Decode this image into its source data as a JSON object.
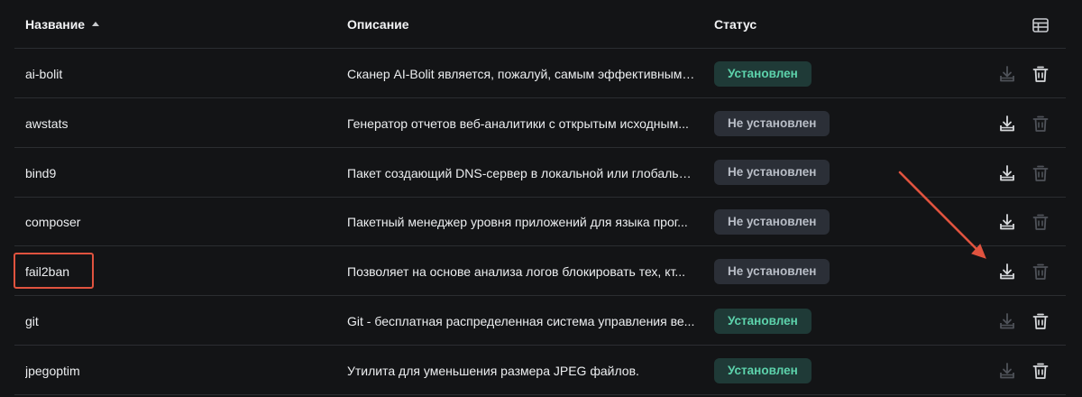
{
  "table": {
    "columns": {
      "name": "Название",
      "description": "Описание",
      "status": "Статус"
    },
    "sort_indicator": "ascending",
    "rows": [
      {
        "name": "ai-bolit",
        "description": "Сканер AI-Bolit является, пожалуй, самым эффективным ...",
        "status": "Установлен",
        "installed": true
      },
      {
        "name": "awstats",
        "description": "Генератор отчетов веб-аналитики с открытым исходным...",
        "status": "Не установлен",
        "installed": false
      },
      {
        "name": "bind9",
        "description": "Пакет создающий DNS-сервер в локальной или глобальн...",
        "status": "Не установлен",
        "installed": false
      },
      {
        "name": "composer",
        "description": "Пакетный менеджер уровня приложений для языка прог...",
        "status": "Не установлен",
        "installed": false
      },
      {
        "name": "fail2ban",
        "description": "Позволяет на основе анализа логов блокировать тех, кт...",
        "status": "Не установлен",
        "installed": false
      },
      {
        "name": "git",
        "description": "Git - бесплатная распределенная система управления ве...",
        "status": "Установлен",
        "installed": true
      },
      {
        "name": "jpegoptim",
        "description": "Утилита для уменьшения размера JPEG файлов.",
        "status": "Установлен",
        "installed": true
      }
    ]
  },
  "icons": {
    "columns_settings": "table-columns-icon",
    "install": "download-tray-icon",
    "delete": "trash-icon",
    "sort": "caret-up-icon"
  },
  "annotations": {
    "highlight_color": "#e0533f",
    "arrow_color": "#e0533f"
  },
  "colors": {
    "background": "#131416",
    "installed_badge_bg": "#1f3a37",
    "installed_badge_text": "#5dd3ac",
    "not_installed_badge_bg": "#2b2f37",
    "not_installed_badge_text": "#b9bec7"
  }
}
